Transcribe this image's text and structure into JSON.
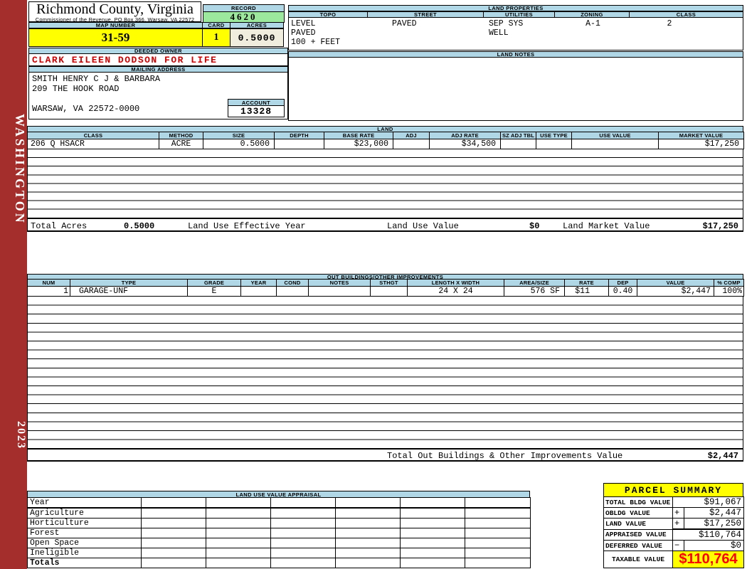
{
  "spine": {
    "county": "WASHINGTON",
    "year": "2023"
  },
  "header": {
    "title": "Richmond County, Virginia",
    "subtitle": "Commissioner of the Revenue, PO Box 366, Warsaw, VA 22572",
    "record_label": "RECORD",
    "record_value": "4620",
    "map_number_label": "MAP NUMBER",
    "map_number_value": "31-59",
    "card_label": "CARD",
    "card_value": "1",
    "acres_label": "ACRES",
    "acres_value": "0.5000"
  },
  "owner": {
    "deeded_owner_label": "DEEDED OWNER",
    "deeded_owner": "CLARK EILEEN DODSON FOR LIFE",
    "mailing_address_label": "MAILING ADDRESS",
    "mailing_lines": [
      "SMITH HENRY C J & BARBARA",
      "209 THE HOOK ROAD",
      "",
      "WARSAW, VA 22572-0000"
    ],
    "account_label": "ACCOUNT",
    "account_value": "13328"
  },
  "land_properties": {
    "title": "LAND PROPERTIES",
    "columns": [
      "TOPO",
      "STREET",
      "UTILITIES",
      "ZONING",
      "CLASS"
    ],
    "topo": [
      "LEVEL",
      "PAVED",
      "100 + FEET"
    ],
    "street": "PAVED",
    "utilities": [
      "SEP SYS",
      "WELL"
    ],
    "zoning": "A-1",
    "class": "2"
  },
  "land_notes": {
    "title": "LAND NOTES"
  },
  "land": {
    "title": "LAND",
    "columns": [
      "CLASS",
      "METHOD",
      "SIZE",
      "DEPTH",
      "BASE RATE",
      "ADJ",
      "ADJ RATE",
      "SZ ADJ TBL",
      "USE TYPE",
      "USE VALUE",
      "MARKET VALUE"
    ],
    "row": {
      "class": "206 Q HSACR",
      "method": "ACRE",
      "size": "0.5000",
      "depth": "",
      "base_rate": "$23,000",
      "adj": "",
      "adj_rate": "$34,500",
      "sz_adj_tbl": "",
      "use_type": "",
      "use_value": "",
      "market_value": "$17,250"
    },
    "totals": {
      "total_acres_label": "Total Acres",
      "total_acres": "0.5000",
      "effective_year_label": "Land Use Effective Year",
      "use_value_label": "Land Use Value",
      "use_value": "$0",
      "market_value_label": "Land Market Value",
      "market_value": "$17,250"
    }
  },
  "out_buildings": {
    "title": "OUT BUILDINGS/OTHER IMPROVEMENTS",
    "columns": [
      "NUM",
      "TYPE",
      "GRADE",
      "YEAR",
      "COND",
      "NOTES",
      "STHGT",
      "LENGTH X WIDTH",
      "AREA/SIZE",
      "RATE",
      "DEP",
      "VALUE",
      "% COMP"
    ],
    "row": {
      "num": "1",
      "type": "GARAGE-UNF",
      "grade": "E",
      "year": "",
      "cond": "",
      "notes": "",
      "sthgt": "",
      "length_width": "24 X 24",
      "area_size": "576 SF",
      "rate": "$11",
      "dep": "0.40",
      "value": "$2,447",
      "pct_comp": "100%"
    },
    "total_label": "Total Out Buildings & Other Improvements Value",
    "total_value": "$2,447"
  },
  "land_use_appraisal": {
    "title": "LAND USE VALUE APPRAISAL",
    "row_labels": [
      "Year",
      "Agriculture",
      "Horticulture",
      "Forest",
      "Open Space",
      "Ineligible",
      "Totals"
    ]
  },
  "parcel_summary": {
    "title": "PARCEL SUMMARY",
    "rows": [
      {
        "label": "TOTAL BLDG VALUE",
        "op": "",
        "value": "$91,067"
      },
      {
        "label": "OBLDG VALUE",
        "op": "+",
        "value": "$2,447"
      },
      {
        "label": "LAND VALUE",
        "op": "+",
        "value": "$17,250"
      },
      {
        "label": "APPRAISED VALUE",
        "op": "",
        "value": "$110,764"
      },
      {
        "label": "DEFERRED VALUE",
        "op": "−",
        "value": "$0"
      }
    ],
    "taxable_label": "TAXABLE VALUE",
    "taxable_value": "$110,764"
  },
  "colors": {
    "spine_red": "#A32E2B",
    "header_blue": "#AFD7E6",
    "record_green": "#9CE89C",
    "highlight_yellow": "#FFFF00",
    "acres_cream": "#F0EDDE",
    "owner_red": "#CC0000",
    "taxable_red": "#FF0000"
  }
}
